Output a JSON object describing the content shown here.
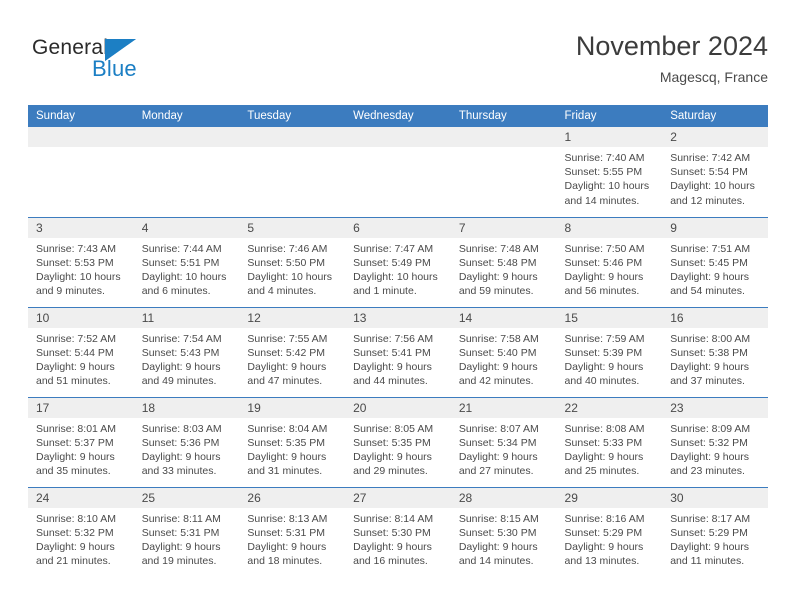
{
  "brand": {
    "name_part1": "General",
    "name_part2": "Blue",
    "logo_icon": "triangle-icon"
  },
  "header": {
    "title": "November 2024",
    "location": "Magescq, France"
  },
  "calendar": {
    "weekday_headers": [
      "Sunday",
      "Monday",
      "Tuesday",
      "Wednesday",
      "Thursday",
      "Friday",
      "Saturday"
    ],
    "colors": {
      "header_blue": "#3c7cbf",
      "daynum_gray": "#efefef",
      "brand_blue": "#1c7fc4",
      "text": "#4a4a4a"
    },
    "weeks": [
      [
        {
          "day": "",
          "empty": true
        },
        {
          "day": "",
          "empty": true
        },
        {
          "day": "",
          "empty": true
        },
        {
          "day": "",
          "empty": true
        },
        {
          "day": "",
          "empty": true
        },
        {
          "day": "1",
          "sunrise": "Sunrise: 7:40 AM",
          "sunset": "Sunset: 5:55 PM",
          "daylight": "Daylight: 10 hours and 14 minutes."
        },
        {
          "day": "2",
          "sunrise": "Sunrise: 7:42 AM",
          "sunset": "Sunset: 5:54 PM",
          "daylight": "Daylight: 10 hours and 12 minutes."
        }
      ],
      [
        {
          "day": "3",
          "sunrise": "Sunrise: 7:43 AM",
          "sunset": "Sunset: 5:53 PM",
          "daylight": "Daylight: 10 hours and 9 minutes."
        },
        {
          "day": "4",
          "sunrise": "Sunrise: 7:44 AM",
          "sunset": "Sunset: 5:51 PM",
          "daylight": "Daylight: 10 hours and 6 minutes."
        },
        {
          "day": "5",
          "sunrise": "Sunrise: 7:46 AM",
          "sunset": "Sunset: 5:50 PM",
          "daylight": "Daylight: 10 hours and 4 minutes."
        },
        {
          "day": "6",
          "sunrise": "Sunrise: 7:47 AM",
          "sunset": "Sunset: 5:49 PM",
          "daylight": "Daylight: 10 hours and 1 minute."
        },
        {
          "day": "7",
          "sunrise": "Sunrise: 7:48 AM",
          "sunset": "Sunset: 5:48 PM",
          "daylight": "Daylight: 9 hours and 59 minutes."
        },
        {
          "day": "8",
          "sunrise": "Sunrise: 7:50 AM",
          "sunset": "Sunset: 5:46 PM",
          "daylight": "Daylight: 9 hours and 56 minutes."
        },
        {
          "day": "9",
          "sunrise": "Sunrise: 7:51 AM",
          "sunset": "Sunset: 5:45 PM",
          "daylight": "Daylight: 9 hours and 54 minutes."
        }
      ],
      [
        {
          "day": "10",
          "sunrise": "Sunrise: 7:52 AM",
          "sunset": "Sunset: 5:44 PM",
          "daylight": "Daylight: 9 hours and 51 minutes."
        },
        {
          "day": "11",
          "sunrise": "Sunrise: 7:54 AM",
          "sunset": "Sunset: 5:43 PM",
          "daylight": "Daylight: 9 hours and 49 minutes."
        },
        {
          "day": "12",
          "sunrise": "Sunrise: 7:55 AM",
          "sunset": "Sunset: 5:42 PM",
          "daylight": "Daylight: 9 hours and 47 minutes."
        },
        {
          "day": "13",
          "sunrise": "Sunrise: 7:56 AM",
          "sunset": "Sunset: 5:41 PM",
          "daylight": "Daylight: 9 hours and 44 minutes."
        },
        {
          "day": "14",
          "sunrise": "Sunrise: 7:58 AM",
          "sunset": "Sunset: 5:40 PM",
          "daylight": "Daylight: 9 hours and 42 minutes."
        },
        {
          "day": "15",
          "sunrise": "Sunrise: 7:59 AM",
          "sunset": "Sunset: 5:39 PM",
          "daylight": "Daylight: 9 hours and 40 minutes."
        },
        {
          "day": "16",
          "sunrise": "Sunrise: 8:00 AM",
          "sunset": "Sunset: 5:38 PM",
          "daylight": "Daylight: 9 hours and 37 minutes."
        }
      ],
      [
        {
          "day": "17",
          "sunrise": "Sunrise: 8:01 AM",
          "sunset": "Sunset: 5:37 PM",
          "daylight": "Daylight: 9 hours and 35 minutes."
        },
        {
          "day": "18",
          "sunrise": "Sunrise: 8:03 AM",
          "sunset": "Sunset: 5:36 PM",
          "daylight": "Daylight: 9 hours and 33 minutes."
        },
        {
          "day": "19",
          "sunrise": "Sunrise: 8:04 AM",
          "sunset": "Sunset: 5:35 PM",
          "daylight": "Daylight: 9 hours and 31 minutes."
        },
        {
          "day": "20",
          "sunrise": "Sunrise: 8:05 AM",
          "sunset": "Sunset: 5:35 PM",
          "daylight": "Daylight: 9 hours and 29 minutes."
        },
        {
          "day": "21",
          "sunrise": "Sunrise: 8:07 AM",
          "sunset": "Sunset: 5:34 PM",
          "daylight": "Daylight: 9 hours and 27 minutes."
        },
        {
          "day": "22",
          "sunrise": "Sunrise: 8:08 AM",
          "sunset": "Sunset: 5:33 PM",
          "daylight": "Daylight: 9 hours and 25 minutes."
        },
        {
          "day": "23",
          "sunrise": "Sunrise: 8:09 AM",
          "sunset": "Sunset: 5:32 PM",
          "daylight": "Daylight: 9 hours and 23 minutes."
        }
      ],
      [
        {
          "day": "24",
          "sunrise": "Sunrise: 8:10 AM",
          "sunset": "Sunset: 5:32 PM",
          "daylight": "Daylight: 9 hours and 21 minutes."
        },
        {
          "day": "25",
          "sunrise": "Sunrise: 8:11 AM",
          "sunset": "Sunset: 5:31 PM",
          "daylight": "Daylight: 9 hours and 19 minutes."
        },
        {
          "day": "26",
          "sunrise": "Sunrise: 8:13 AM",
          "sunset": "Sunset: 5:31 PM",
          "daylight": "Daylight: 9 hours and 18 minutes."
        },
        {
          "day": "27",
          "sunrise": "Sunrise: 8:14 AM",
          "sunset": "Sunset: 5:30 PM",
          "daylight": "Daylight: 9 hours and 16 minutes."
        },
        {
          "day": "28",
          "sunrise": "Sunrise: 8:15 AM",
          "sunset": "Sunset: 5:30 PM",
          "daylight": "Daylight: 9 hours and 14 minutes."
        },
        {
          "day": "29",
          "sunrise": "Sunrise: 8:16 AM",
          "sunset": "Sunset: 5:29 PM",
          "daylight": "Daylight: 9 hours and 13 minutes."
        },
        {
          "day": "30",
          "sunrise": "Sunrise: 8:17 AM",
          "sunset": "Sunset: 5:29 PM",
          "daylight": "Daylight: 9 hours and 11 minutes."
        }
      ]
    ]
  }
}
